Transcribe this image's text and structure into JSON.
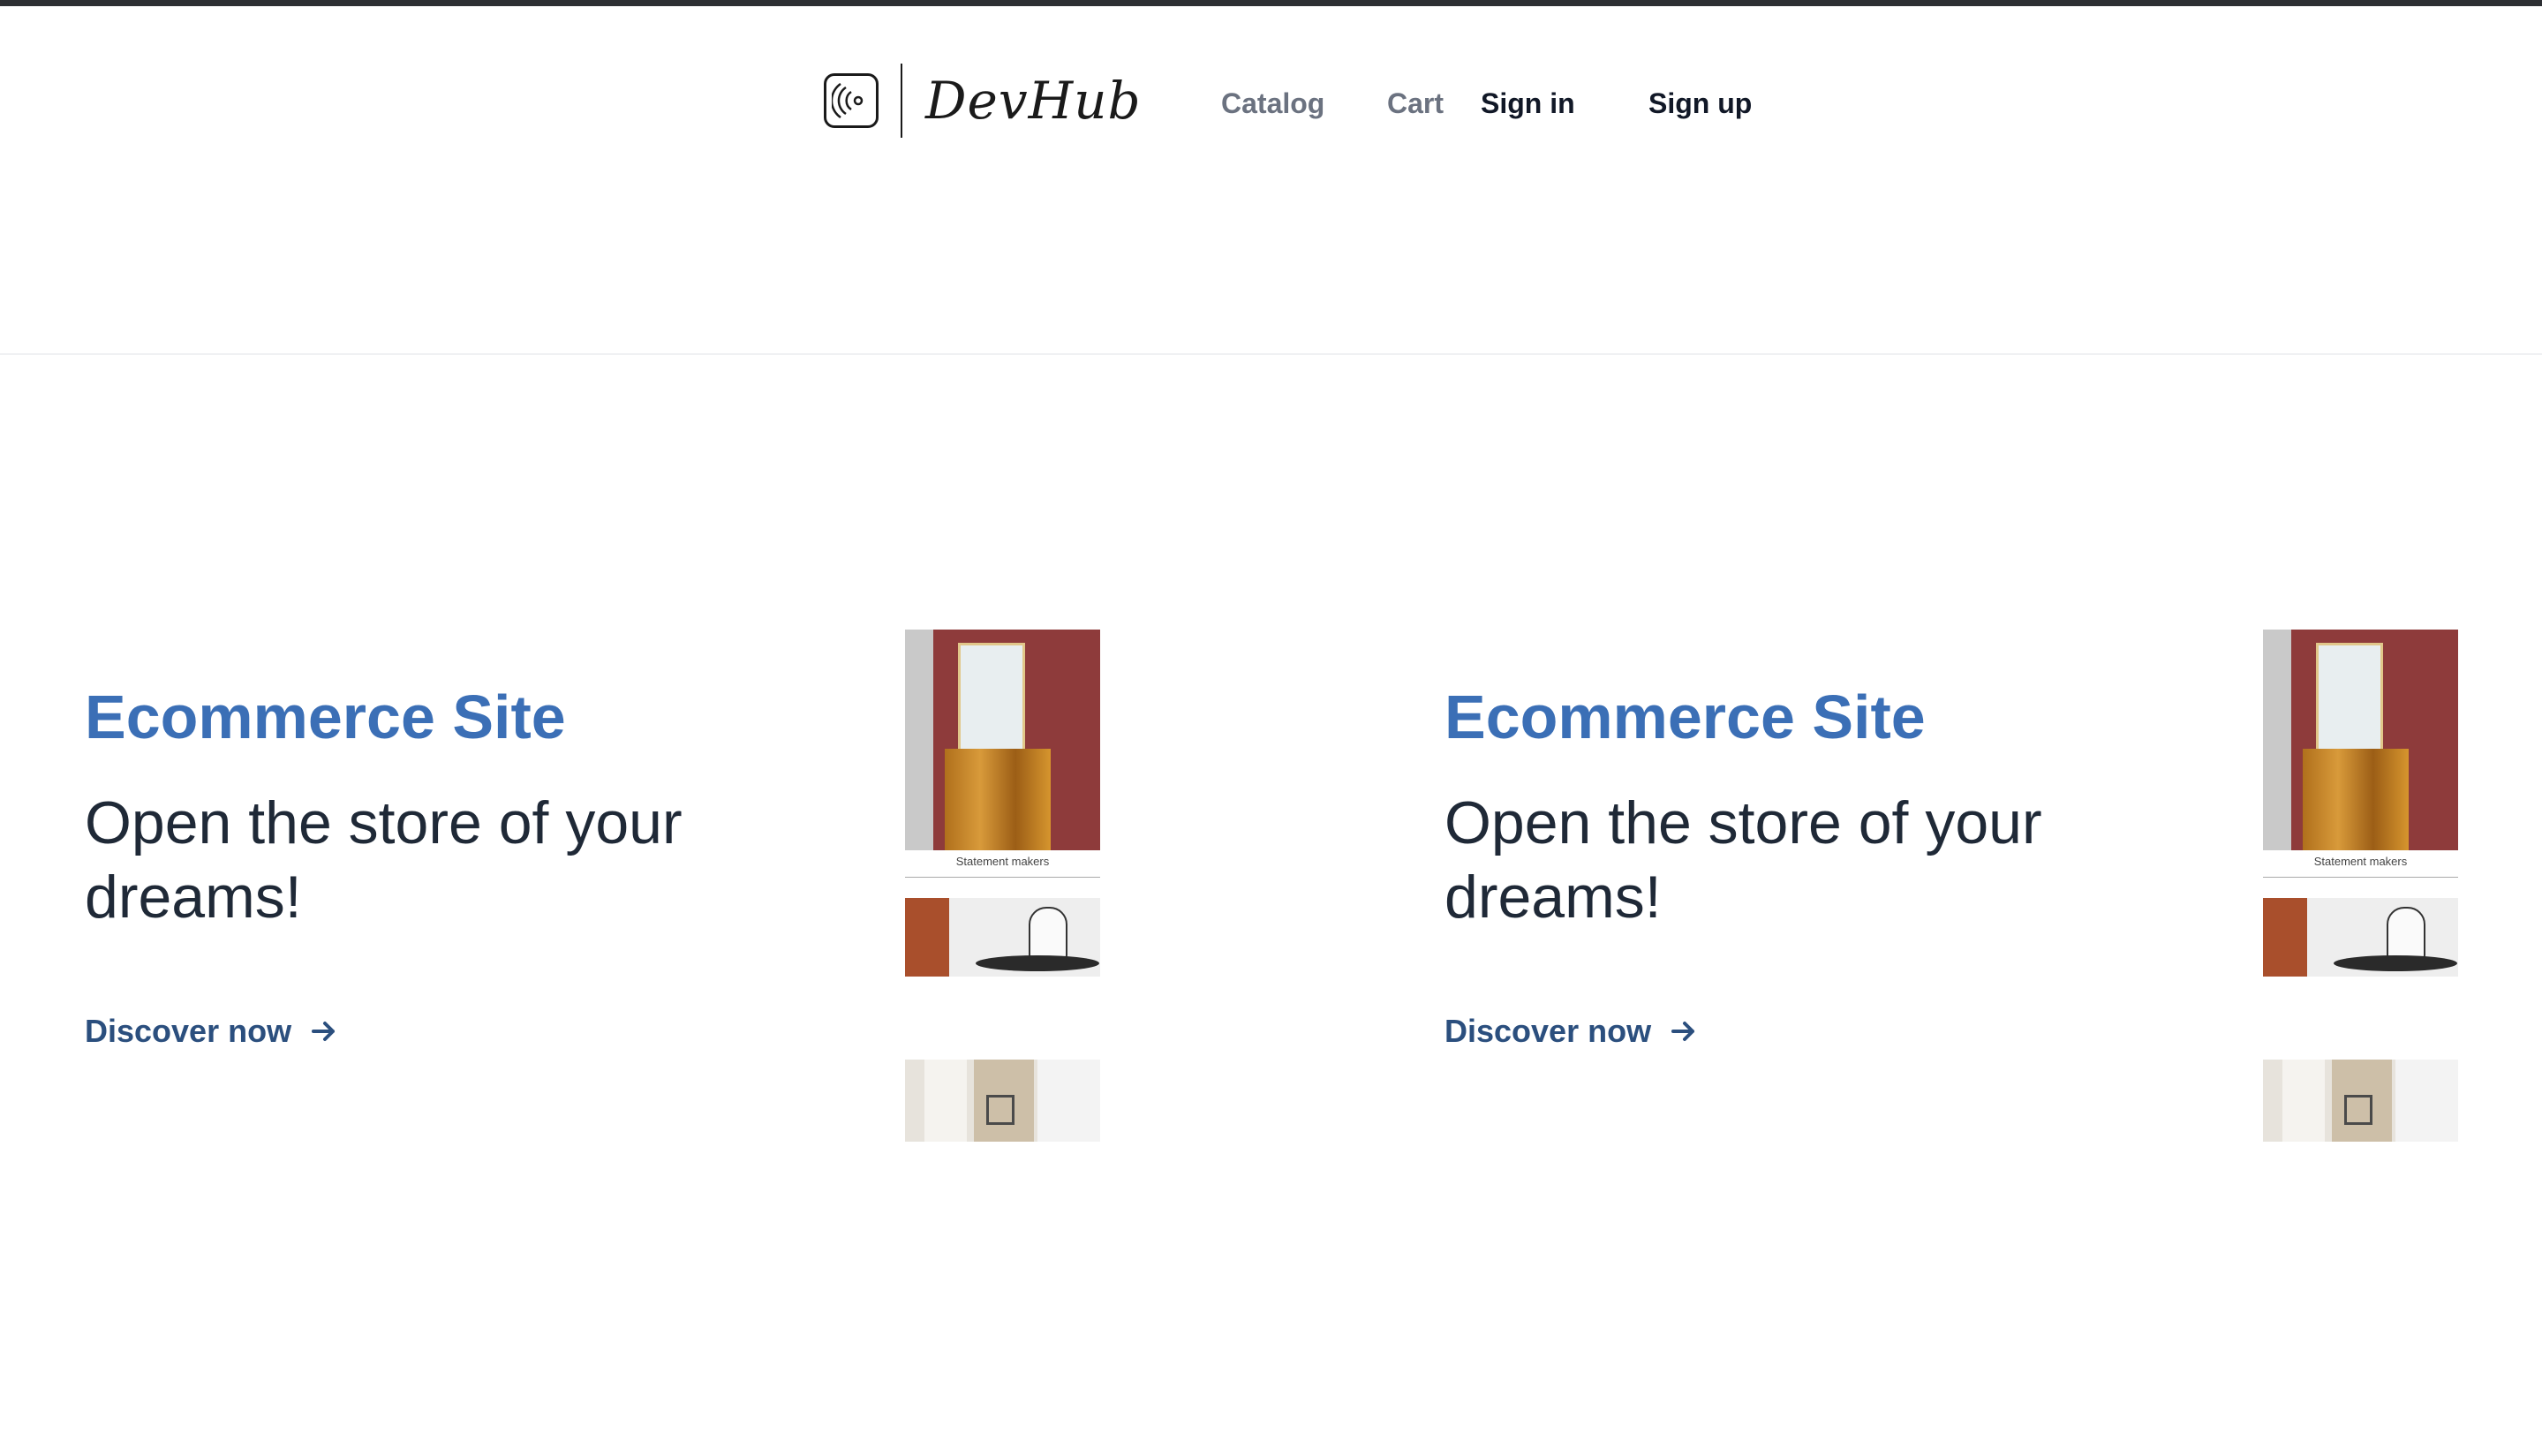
{
  "brand": {
    "name": "DevHub",
    "icon": "broadcast-icon"
  },
  "nav": {
    "catalog": "Catalog",
    "cart": "Cart",
    "sign_in": "Sign in",
    "sign_up": "Sign up"
  },
  "cards": [
    {
      "title": "Ecommerce Site",
      "subtitle": "Open the store of your dreams!",
      "link": "Discover now",
      "image_caption": "Statement makers"
    },
    {
      "title": "Ecommerce Site",
      "subtitle": "Open the store of your dreams!",
      "link": "Discover now",
      "image_caption": "Statement makers"
    }
  ],
  "colors": {
    "accent": "#3b6fb6",
    "link": "#2b4f7e",
    "muted_nav": "#6b7280",
    "topbar": "#2d2f33"
  }
}
